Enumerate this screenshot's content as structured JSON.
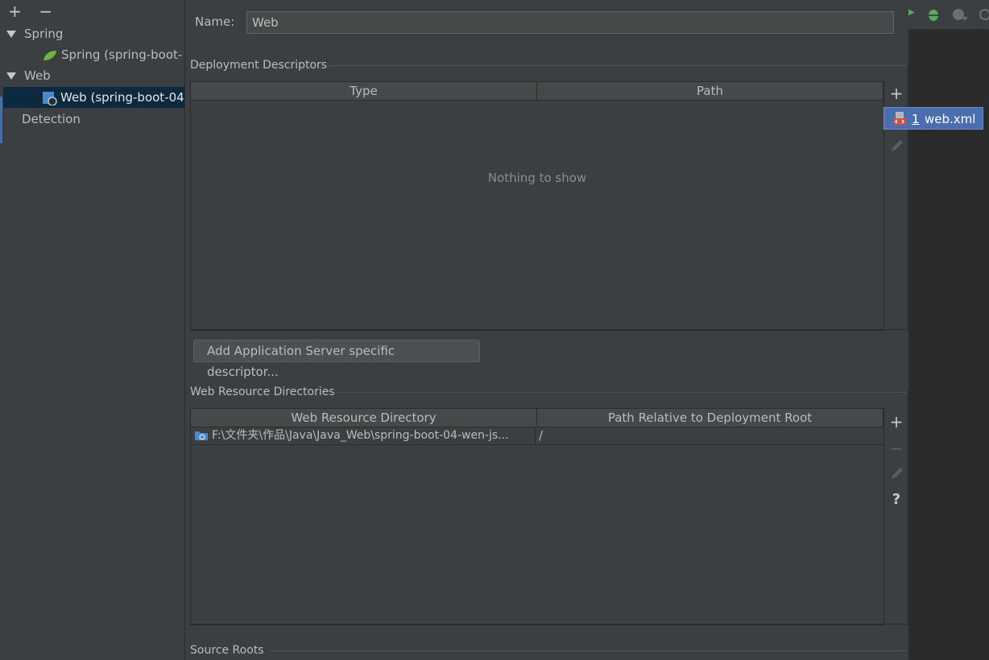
{
  "tree": {
    "toolbar": {
      "add": "+",
      "remove": "−"
    },
    "items": [
      {
        "label": "Spring",
        "kind": "group"
      },
      {
        "label": "Spring (spring-boot-",
        "kind": "spring-facet"
      },
      {
        "label": "Web",
        "kind": "group"
      },
      {
        "label": "Web (spring-boot-04",
        "kind": "web-facet",
        "selected": true
      },
      {
        "label": "Detection",
        "kind": "node"
      }
    ]
  },
  "form": {
    "name_label": "Name:",
    "name_value": "Web"
  },
  "deployment": {
    "title": "Deployment Descriptors",
    "columns": [
      "Type",
      "Path"
    ],
    "empty_text": "Nothing to show",
    "add_server_button": "Add Application Server specific descriptor..."
  },
  "popup": {
    "number": "1",
    "label": "web.xml"
  },
  "web_resources": {
    "title": "Web Resource Directories",
    "columns": [
      "Web Resource Directory",
      "Path Relative to Deployment Root"
    ],
    "rows": [
      {
        "directory": "F:\\文件夹\\作品\\Java\\Java_Web\\spring-boot-04-wen-js...",
        "path": "/"
      }
    ]
  },
  "source_roots": {
    "title": "Source Roots"
  },
  "toolbar_icons": {
    "add": "+",
    "remove": "−",
    "help": "?"
  },
  "colors": {
    "accent": "#4b6eaf",
    "spring_green": "#6db33f",
    "background": "#3c3f41"
  }
}
